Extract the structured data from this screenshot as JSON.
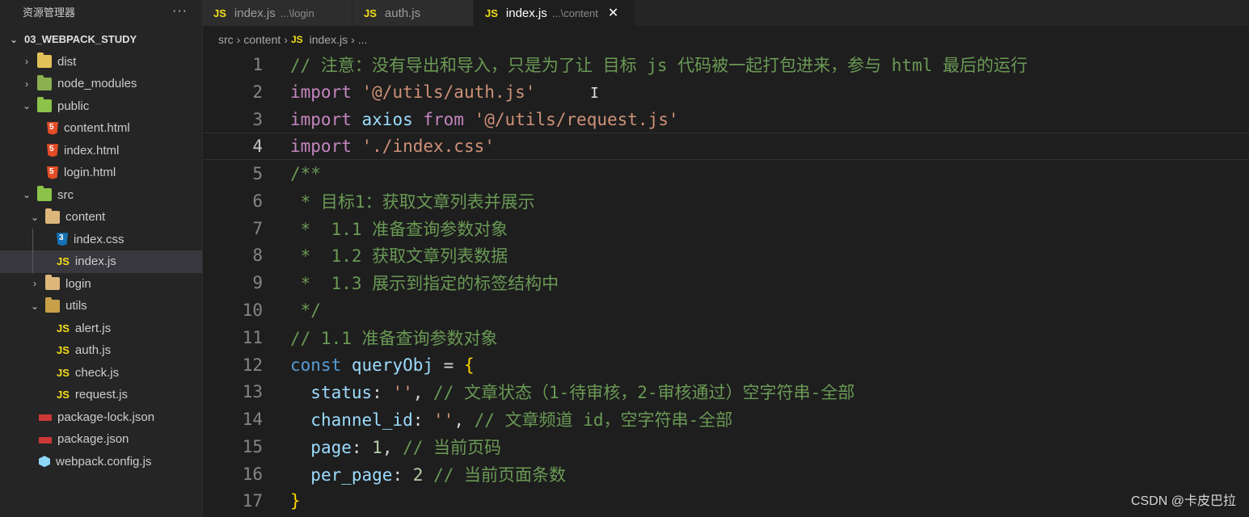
{
  "explorer": {
    "title": "资源管理器",
    "more": "···",
    "root": "03_WEBPACK_STUDY",
    "items": [
      {
        "label": "dist"
      },
      {
        "label": "node_modules"
      },
      {
        "label": "public"
      },
      {
        "label": "content.html"
      },
      {
        "label": "index.html"
      },
      {
        "label": "login.html"
      },
      {
        "label": "src"
      },
      {
        "label": "content"
      },
      {
        "label": "index.css"
      },
      {
        "label": "index.js"
      },
      {
        "label": "login"
      },
      {
        "label": "utils"
      },
      {
        "label": "alert.js"
      },
      {
        "label": "auth.js"
      },
      {
        "label": "check.js"
      },
      {
        "label": "request.js"
      },
      {
        "label": "package-lock.json"
      },
      {
        "label": "package.json"
      },
      {
        "label": "webpack.config.js"
      }
    ]
  },
  "tabs": [
    {
      "icon": "JS",
      "label": "index.js",
      "desc": "...\\login"
    },
    {
      "icon": "JS",
      "label": "auth.js",
      "desc": ""
    },
    {
      "icon": "JS",
      "label": "index.js",
      "desc": "...\\content",
      "close": "✕"
    }
  ],
  "breadcrumb": {
    "parts": [
      "src",
      "content"
    ],
    "icon": "JS",
    "file": "index.js",
    "tail": "..."
  },
  "editor": {
    "line_numbers": [
      "1",
      "2",
      "3",
      "4",
      "5",
      "6",
      "7",
      "8",
      "9",
      "10",
      "11",
      "12",
      "13",
      "14",
      "15",
      "16",
      "17"
    ],
    "current_line": 4
  },
  "code": {
    "l1": "// 注意：没有导出和导入，只是为了让 目标 js 代码被一起打包进来，参与 html 最后的运行",
    "l2_kw": "import",
    "l2_str": "'@/utils/auth.js'",
    "l3_kw": "import",
    "l3_var": "axios",
    "l3_from": "from",
    "l3_str": "'@/utils/request.js'",
    "l4_kw": "import",
    "l4_str": "'./index.css'",
    "l5": "/**",
    "l6": " * 目标1：获取文章列表并展示",
    "l7": " *  1.1 准备查询参数对象",
    "l8": " *  1.2 获取文章列表数据",
    "l9": " *  1.3 展示到指定的标签结构中",
    "l10": " */",
    "l11": "// 1.1 准备查询参数对象",
    "l12_kw": "const",
    "l12_var": "queryObj",
    "l12_eq": " = ",
    "l12_brace": "{",
    "l13_key": "status",
    "l13_colon": ": ",
    "l13_str": "''",
    "l13_comma": ", ",
    "l13_cm": "// 文章状态（1-待审核，2-审核通过）空字符串-全部",
    "l14_key": "channel_id",
    "l14_colon": ": ",
    "l14_str": "''",
    "l14_comma": ", ",
    "l14_cm": "// 文章频道 id，空字符串-全部",
    "l15_key": "page",
    "l15_colon": ": ",
    "l15_num": "1",
    "l15_comma": ", ",
    "l15_cm": "// 当前页码",
    "l16_key": "per_page",
    "l16_colon": ": ",
    "l16_num": "2",
    "l16_sp": " ",
    "l16_cm": "// 当前页面条数",
    "l17_brace": "}"
  },
  "watermark": "CSDN @卡皮巴拉",
  "colors": {
    "keyword": "#c586c0",
    "string": "#ce9178",
    "comment": "#6a9955",
    "variable": "#9cdcfe",
    "js_icon": "#f5de19"
  }
}
